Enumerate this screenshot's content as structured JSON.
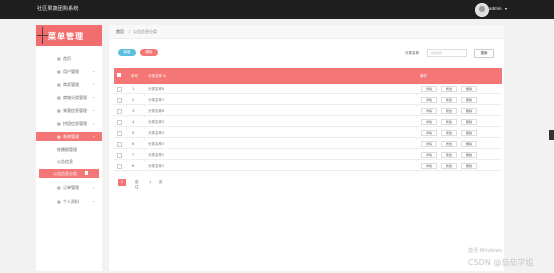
{
  "header": {
    "app_title": "社区果蔬团购系统",
    "user_name": "admin",
    "user_caret": "▾"
  },
  "sidebar": {
    "title": "菜单管理",
    "items": [
      {
        "icon": "▦",
        "label": "首页",
        "chevron": ""
      },
      {
        "icon": "▦",
        "label": "用户管理",
        "chevron": "⌄"
      },
      {
        "icon": "▦",
        "label": "商家管理",
        "chevron": "⌄"
      },
      {
        "icon": "▦",
        "label": "商城分类管理",
        "chevron": "⌄"
      },
      {
        "icon": "▦",
        "label": "果蔬信息管理",
        "chevron": "⌄"
      },
      {
        "icon": "▦",
        "label": "拼团信息管理",
        "chevron": "⌄"
      },
      {
        "icon": "▦",
        "label": "系统管理",
        "chevron": "⌄"
      },
      {
        "icon": "",
        "label": "轮播图管理",
        "chevron": ""
      },
      {
        "icon": "",
        "label": "公告信息",
        "chevron": ""
      },
      {
        "icon": "",
        "label": "公告信息分类",
        "chevron": ""
      },
      {
        "icon": "▦",
        "label": "订单管理",
        "chevron": "⌄"
      },
      {
        "icon": "▦",
        "label": "个人资料",
        "chevron": "⌄"
      }
    ]
  },
  "breadcrumb": {
    "home": "首页",
    "sep": "/",
    "current": "公告信息分类"
  },
  "toolbar": {
    "add_label": "新增",
    "delete_label": "删除",
    "search_label": "分类名称",
    "search_placeholder": "分类名称",
    "search_button": "搜索"
  },
  "table": {
    "headers": {
      "index": "序号",
      "name": "分类名称 ⇅",
      "actions": "操作"
    },
    "rows": [
      {
        "index": "1",
        "name": "分类名称8"
      },
      {
        "index": "2",
        "name": "分类名称7"
      },
      {
        "index": "3",
        "name": "分类名称6"
      },
      {
        "index": "4",
        "name": "分类名称5"
      },
      {
        "index": "5",
        "name": "分类名称4"
      },
      {
        "index": "6",
        "name": "分类名称3"
      },
      {
        "index": "7",
        "name": "分类名称2"
      },
      {
        "index": "8",
        "name": "分类名称1"
      }
    ],
    "row_actions": {
      "detail": "详情",
      "edit": "修改",
      "delete": "删除"
    }
  },
  "pager": {
    "current": "1",
    "prev": "前往",
    "page": "1",
    "unit": "页"
  },
  "watermark": {
    "line1": "激活 Windows",
    "line2": "CSDN @茄茄学姐"
  },
  "colors": {
    "accent": "#f47676",
    "topbar": "#1f1f1f",
    "add_button": "#5bc0de"
  }
}
